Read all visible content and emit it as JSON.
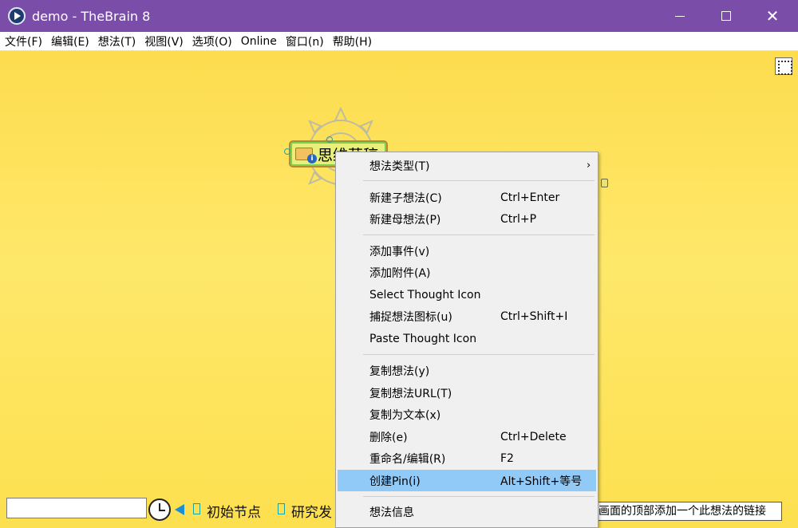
{
  "window": {
    "title": "demo - TheBrain 8",
    "close_glyph": "✕"
  },
  "menubar": [
    "文件(F)",
    "编辑(E)",
    "想法(T)",
    "视图(V)",
    "选项(O)",
    "Online",
    "窗口(n)",
    "帮助(H)"
  ],
  "thought": {
    "label": "思维草稿"
  },
  "bottom": {
    "search_value": "",
    "bookmarks": [
      "初始节点",
      "研究发"
    ]
  },
  "tooltip": "在画面的顶部添加一个此想法的链接",
  "context_menu": {
    "items": [
      {
        "label": "想法类型(T)",
        "shortcut": "",
        "submenu": "›"
      },
      {
        "label": "新建子想法(C)",
        "shortcut": "Ctrl+Enter"
      },
      {
        "label": "新建母想法(P)",
        "shortcut": "Ctrl+P"
      },
      {
        "label": "添加事件(v)",
        "shortcut": ""
      },
      {
        "label": "添加附件(A)",
        "shortcut": ""
      },
      {
        "label": "Select Thought Icon",
        "shortcut": ""
      },
      {
        "label": "捕捉想法图标(u)",
        "shortcut": "Ctrl+Shift+I"
      },
      {
        "label": "Paste Thought Icon",
        "shortcut": ""
      },
      {
        "label": "复制想法(y)",
        "shortcut": ""
      },
      {
        "label": "复制想法URL(T)",
        "shortcut": ""
      },
      {
        "label": "复制为文本(x)",
        "shortcut": ""
      },
      {
        "label": "删除(e)",
        "shortcut": "Ctrl+Delete"
      },
      {
        "label": "重命名/编辑(R)",
        "shortcut": "F2"
      },
      {
        "label": "创建Pin(i)",
        "shortcut": "Alt+Shift+等号",
        "highlighted": true
      },
      {
        "label": "想法信息",
        "shortcut": ""
      }
    ]
  },
  "colors": {
    "titlebar": "#7a4ea8",
    "canvas": "#fee86a",
    "menu_highlight": "#91c9f7"
  }
}
